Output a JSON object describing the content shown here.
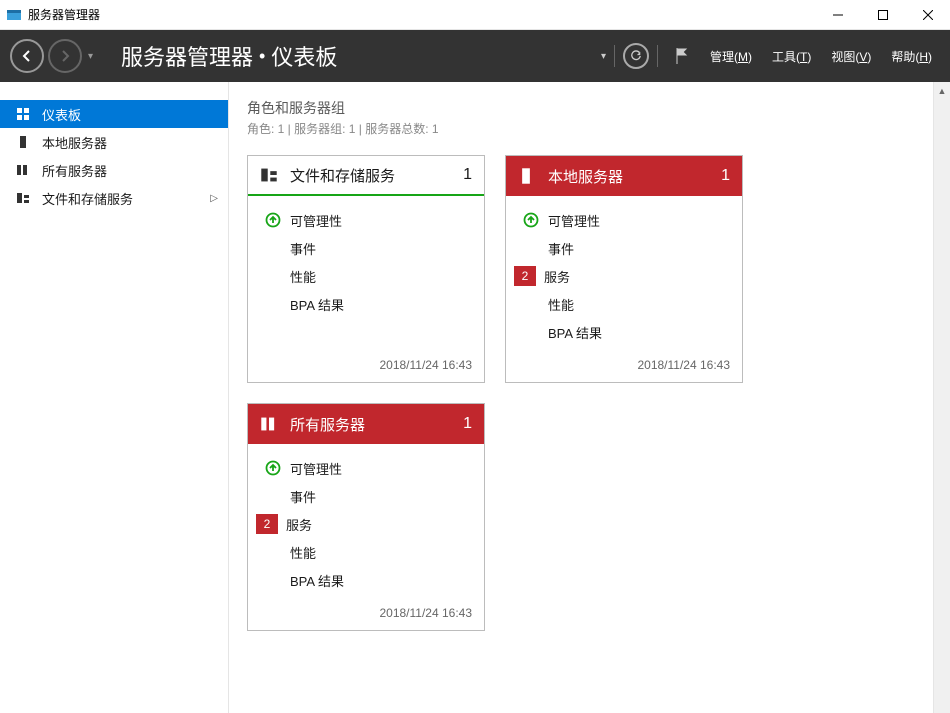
{
  "window": {
    "title": "服务器管理器"
  },
  "header": {
    "breadcrumb_root": "服务器管理器",
    "breadcrumb_current": "仪表板",
    "menu": {
      "manage": "管理(M)",
      "tools": "工具(T)",
      "view": "视图(V)",
      "help": "帮助(H)"
    }
  },
  "sidebar": {
    "items": [
      {
        "label": "仪表板",
        "icon": "dashboard"
      },
      {
        "label": "本地服务器",
        "icon": "server"
      },
      {
        "label": "所有服务器",
        "icon": "servers"
      },
      {
        "label": "文件和存储服务",
        "icon": "storage",
        "expandable": true
      }
    ]
  },
  "main": {
    "section_title": "角色和服务器组",
    "section_sub": "角色: 1 | 服务器组: 1 | 服务器总数: 1",
    "tiles": [
      {
        "title": "文件和存储服务",
        "count": "1",
        "header_style": "light",
        "rows": [
          {
            "icon": "up",
            "label": "可管理性"
          },
          {
            "icon": "",
            "label": "事件"
          },
          {
            "icon": "",
            "label": "性能"
          },
          {
            "icon": "",
            "label": "BPA 结果"
          }
        ],
        "timestamp": "2018/11/24 16:43"
      },
      {
        "title": "本地服务器",
        "count": "1",
        "header_style": "red",
        "rows": [
          {
            "icon": "up",
            "label": "可管理性"
          },
          {
            "icon": "",
            "label": "事件"
          },
          {
            "icon": "badge",
            "badge": "2",
            "label": "服务"
          },
          {
            "icon": "",
            "label": "性能"
          },
          {
            "icon": "",
            "label": "BPA 结果"
          }
        ],
        "timestamp": "2018/11/24 16:43"
      },
      {
        "title": "所有服务器",
        "count": "1",
        "header_style": "red",
        "rows": [
          {
            "icon": "up",
            "label": "可管理性"
          },
          {
            "icon": "",
            "label": "事件"
          },
          {
            "icon": "badge",
            "badge": "2",
            "label": "服务"
          },
          {
            "icon": "",
            "label": "性能"
          },
          {
            "icon": "",
            "label": "BPA 结果"
          }
        ],
        "timestamp": "2018/11/24 16:43"
      }
    ]
  }
}
